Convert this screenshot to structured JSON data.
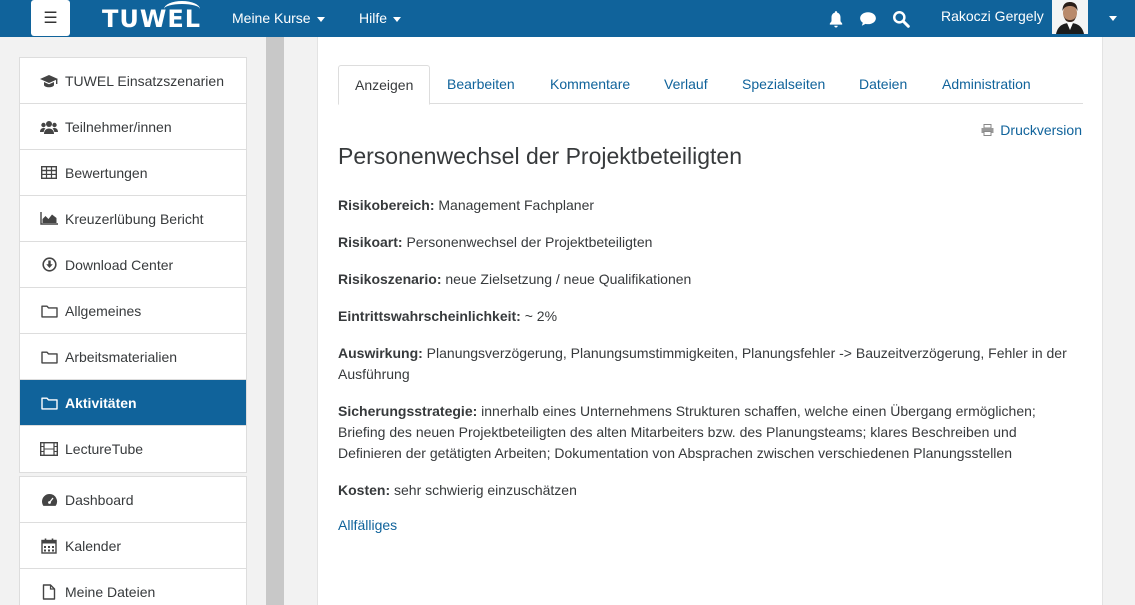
{
  "navbar": {
    "menu_icon": "hamburger-icon",
    "logo": "TUWEL",
    "links": [
      "Meine Kurse",
      "Hilfe"
    ],
    "username": "Rakoczi Gergely"
  },
  "sidebar": {
    "group1": [
      {
        "label": "TUWEL Einsatzszenarien",
        "icon": "graduation-cap-icon"
      },
      {
        "label": "Teilnehmer/innen",
        "icon": "users-icon"
      },
      {
        "label": "Bewertungen",
        "icon": "table-icon"
      },
      {
        "label": "Kreuzerlübung Bericht",
        "icon": "area-chart-icon"
      },
      {
        "label": "Download Center",
        "icon": "download-icon"
      },
      {
        "label": "Allgemeines",
        "icon": "folder-icon"
      },
      {
        "label": "Arbeitsmaterialien",
        "icon": "folder-icon"
      },
      {
        "label": "Aktivitäten",
        "icon": "folder-icon",
        "active": true
      },
      {
        "label": "LectureTube",
        "icon": "film-icon"
      }
    ],
    "group2": [
      {
        "label": "Dashboard",
        "icon": "dashboard-icon"
      },
      {
        "label": "Kalender",
        "icon": "calendar-icon"
      },
      {
        "label": "Meine Dateien",
        "icon": "file-icon"
      }
    ]
  },
  "tabs": [
    "Anzeigen",
    "Bearbeiten",
    "Kommentare",
    "Verlauf",
    "Spezialseiten",
    "Dateien",
    "Administration"
  ],
  "print_label": "Druckversion",
  "page_title": "Personenwechsel der Projektbeteiligten",
  "fields": [
    {
      "label": "Risikobereich:",
      "value": " Management Fachplaner"
    },
    {
      "label": "Risikoart:",
      "value": " Personenwechsel der Projektbeteiligten"
    },
    {
      "label": "Risikoszenario:",
      "value": " neue Zielsetzung / neue Qualifikationen"
    },
    {
      "label": "Eintrittswahrscheinlichkeit:",
      "value": " ~ 2%"
    },
    {
      "label": "Auswirkung:",
      "value": " Planungsverzögerung, Planungsumstimmigkeiten, Planungsfehler -> Bauzeitverzögerung, Fehler in der Ausführung"
    },
    {
      "label": "Sicherungsstrategie:",
      "value": " innerhalb eines Unternehmens Strukturen schaffen, welche einen Übergang ermöglichen; Briefing des neuen Projektbeteiligten des alten Mitarbeiters bzw. des Planungsteams; klares Beschreiben und Definieren der getätigten Arbeiten; Dokumentation von Absprachen zwischen verschiedenen Planungsstellen"
    },
    {
      "label": "Kosten:",
      "value": " sehr schwierig einzuschätzen"
    }
  ],
  "bottom_link": "Allfälliges"
}
